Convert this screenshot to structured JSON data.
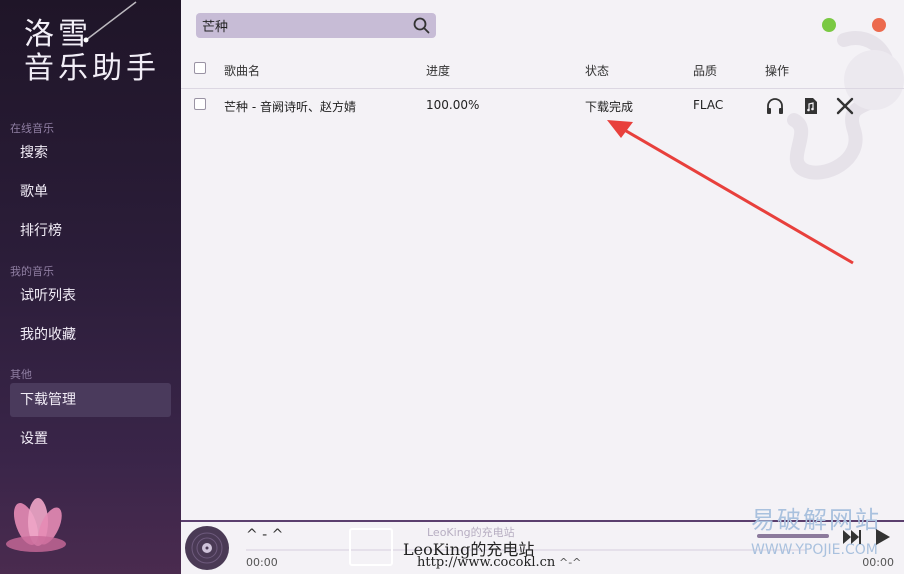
{
  "app": {
    "logo_line1": "洛雪",
    "logo_line2": "音乐助手"
  },
  "sidebar": {
    "groups": [
      {
        "label": "在线音乐",
        "items": [
          {
            "label": "搜索"
          },
          {
            "label": "歌单"
          },
          {
            "label": "排行榜"
          }
        ]
      },
      {
        "label": "我的音乐",
        "items": [
          {
            "label": "试听列表"
          },
          {
            "label": "我的收藏"
          }
        ]
      },
      {
        "label": "其他",
        "items": [
          {
            "label": "下载管理"
          },
          {
            "label": "设置"
          }
        ]
      }
    ],
    "active": "下载管理"
  },
  "search": {
    "value": "芒种",
    "placeholder": ""
  },
  "table": {
    "headers": {
      "name": "歌曲名",
      "progress": "进度",
      "status": "状态",
      "quality": "品质",
      "actions": "操作"
    },
    "rows": [
      {
        "name": "芒种 - 音阙诗听、赵方婧",
        "progress": "100.00%",
        "status": "下载完成",
        "quality": "FLAC"
      }
    ]
  },
  "player": {
    "title": "^ - ^",
    "time_current": "00:00",
    "time_total": "00:00",
    "mid_text": "^-^"
  },
  "watermarks": {
    "site1_small": "LeoKing的充电站",
    "site1_name": "LeoKing的充电站",
    "site1_url": "http://www.cocokl.cn",
    "site2_name": "易破解网站",
    "site2_url": "WWW.YPOJIE.COM"
  },
  "colors": {
    "sidebar_bg": "#2b1d39",
    "accent": "#5b3f6e",
    "win_min": "#7ac943",
    "win_close": "#ec6a4e",
    "arrow": "#e8403c"
  }
}
